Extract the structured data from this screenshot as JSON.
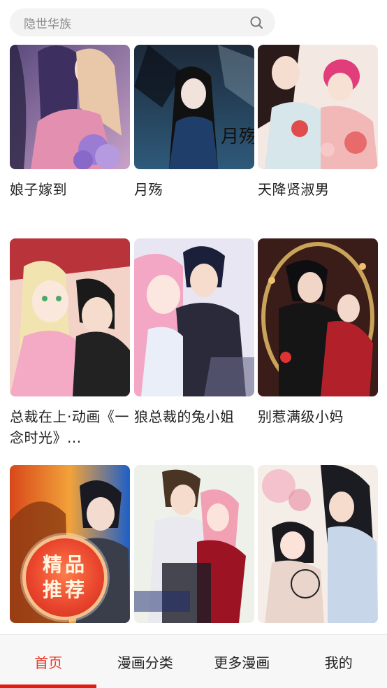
{
  "search": {
    "placeholder": "隐世华族"
  },
  "comics": [
    {
      "title": "娘子嫁到"
    },
    {
      "title": "月殇",
      "cover_text": "月殇"
    },
    {
      "title": "天降贤淑男"
    },
    {
      "title": "总裁在上·动画《一念时光》..."
    },
    {
      "title": "狼总裁的兔小姐"
    },
    {
      "title": "别惹满级小妈"
    },
    {
      "title": "",
      "badge": [
        "精品",
        "推荐"
      ]
    },
    {
      "title": ""
    },
    {
      "title": ""
    }
  ],
  "tabs": [
    {
      "label": "首页",
      "active": true
    },
    {
      "label": "漫画分类",
      "active": false
    },
    {
      "label": "更多漫画",
      "active": false
    },
    {
      "label": "我的",
      "active": false
    }
  ],
  "colors": {
    "accent": "#e31b12",
    "active_tab_text": "#e83b2a",
    "tabbar_bg": "#f7f7f7",
    "search_bg": "#f3f3f3"
  }
}
